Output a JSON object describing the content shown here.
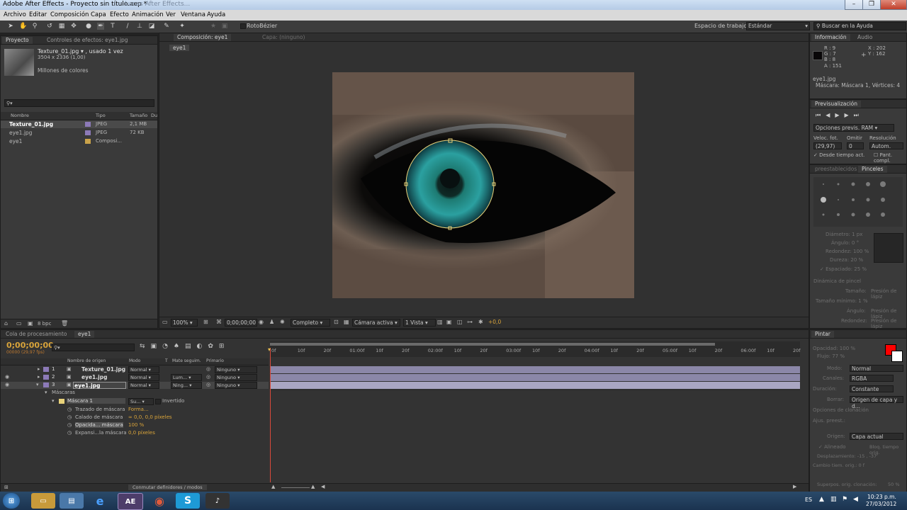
{
  "window": {
    "title": "Adobe After Effects - Proyecto sin título.aep *",
    "ghost_title": "Lucas After Effects..."
  },
  "menu": [
    "Archivo",
    "Editar",
    "Composición",
    "Capa",
    "Efecto",
    "Animación",
    "Ver",
    "Ventana",
    "Ayuda"
  ],
  "toolbar": {
    "rotobezier": "RotoBézier",
    "workspace_label": "Espacio de trabajo:",
    "workspace_value": "Estándar",
    "help_placeholder": "Buscar en la Ayuda"
  },
  "project": {
    "tabs": [
      "Proyecto",
      "Controles de efectos: eye1.jpg"
    ],
    "selected_name": "Texture_01.jpg ▾ , usado 1 vez",
    "selected_dims": "3504 x 2336 (1,00)",
    "selected_colors": "Millones de colores",
    "columns": [
      "Nombre",
      "Tipo",
      "Tamaño",
      "Du"
    ],
    "items": [
      {
        "name": "Texture_01.jpg",
        "type": "JPEG",
        "size": "2,1 MB",
        "color": "#8c7ab8"
      },
      {
        "name": "eye1.jpg",
        "type": "JPEG",
        "size": "72 KB",
        "color": "#8c7ab8"
      },
      {
        "name": "eye1",
        "type": "Composi...",
        "size": "",
        "color": "#c9a24a"
      }
    ],
    "bpc": "8 bpc"
  },
  "composition": {
    "tab": "Composición: eye1",
    "layer_tab": "Capa: (ninguno)",
    "crumb": "eye1",
    "zoom": "100%",
    "timecode": "0;00;00;00",
    "quality": "Completo",
    "camera": "Cámara activa",
    "views": "1 Vista",
    "exposure": "+0,0"
  },
  "info": {
    "tabs": [
      "Información",
      "Audio"
    ],
    "r": "R : 9",
    "g": "G : 7",
    "b": "B : 8",
    "a": "A : 151",
    "x": "X : 202",
    "y": "Y : 162",
    "line1": "eye1.jpg",
    "line2": "Máscara: Máscara 1, Vértices: 4"
  },
  "preview": {
    "title": "Previsualización",
    "ram": "Opciones previs. RAM",
    "fps_label": "Veloc. fot.",
    "skip_label": "Omitir",
    "res_label": "Resolución",
    "fps": "(29,97)",
    "skip": "0",
    "res": "Autom.",
    "from_current": "Desde tiempo act.",
    "fullscreen": "Pant. compl."
  },
  "brushes": {
    "tabs": [
      "preestablecidos",
      "Pinceles"
    ],
    "diameter": "Diámetro: 1 px",
    "angle": "Ángulo: 0 °",
    "roundness": "Redondez: 100 %",
    "hardness": "Dureza: 20 %",
    "spacing": "Espaciado: 25 %",
    "dynamics": "Dinámica de pincel",
    "size": "Tamaño:",
    "min_size": "Tamaño mínimo: 1 %",
    "angle2": "Ángulo:",
    "roundness2": "Redondez:",
    "option_val": "Presión de lápiz"
  },
  "paint": {
    "tab": "Pintar",
    "opacity": "Opacidad: 100 %",
    "flow": "Flujo: 77 %",
    "mode_label": "Modo:",
    "mode": "Normal",
    "channels_label": "Canales:",
    "channels": "RGBA",
    "duration_label": "Duración:",
    "duration": "Constante",
    "erase_label": "Borrar:",
    "erase": "Origen de capa y d...",
    "clone_opts": "Opciones de clonación",
    "preset_label": "Ajus. preest.:",
    "source_label": "Origen:",
    "source": "Capa actual",
    "aligned": "Alineado",
    "lock_time": "Bloq. tiempo orig.",
    "offset": "Desplazamiento: -15 , -37",
    "source_time": "Cambio tiem. orig.: 0 f",
    "overlay": "Superpos. orig. clonación:",
    "overlay_pct": "50 %"
  },
  "timeline": {
    "tabs": [
      "Cola de procesamiento",
      "eye1"
    ],
    "timecode": "0;00;00;00",
    "fps": "00000 (29,97 fps)",
    "columns": [
      "Nombre de origen",
      "Modo",
      "T",
      "Mate seguim.",
      "Primario"
    ],
    "layers": [
      {
        "num": "1",
        "name": "Texture_01.jpg",
        "mode": "Normal",
        "matte": "",
        "parent": "Ninguno"
      },
      {
        "num": "2",
        "name": "eye1.jpg",
        "mode": "Normal",
        "matte": "Lum...",
        "parent": "Ninguno"
      },
      {
        "num": "3",
        "name": "eye1.jpg",
        "mode": "Normal",
        "matte": "Ning...",
        "parent": "Ninguno"
      }
    ],
    "masks_label": "Máscaras",
    "mask_name": "Máscara 1",
    "mask_mode": "Su...",
    "inverted": "Invertido",
    "props": [
      {
        "name": "Trazado de máscara",
        "value": "Forma..."
      },
      {
        "name": "Calado de máscara",
        "value": "∞ 0,0, 0,0 píxeles"
      },
      {
        "name": "Opacida... máscara",
        "value": "100 %"
      },
      {
        "name": "Expansi...la máscara",
        "value": "0,0 píxeles"
      }
    ],
    "ruler": [
      "0f",
      "10f",
      "20f",
      "01:00f",
      "10f",
      "20f",
      "02:00f",
      "10f",
      "20f",
      "03:00f",
      "10f",
      "20f",
      "04:00f",
      "10f",
      "20f",
      "05:00f",
      "10f",
      "20f",
      "06:00f",
      "10f",
      "20f"
    ],
    "switch_modes": "Conmutar definidores / modos"
  },
  "taskbar": {
    "lang": "ES",
    "time": "10:23 p.m.",
    "date": "27/03/2012",
    "ae": "AE"
  }
}
